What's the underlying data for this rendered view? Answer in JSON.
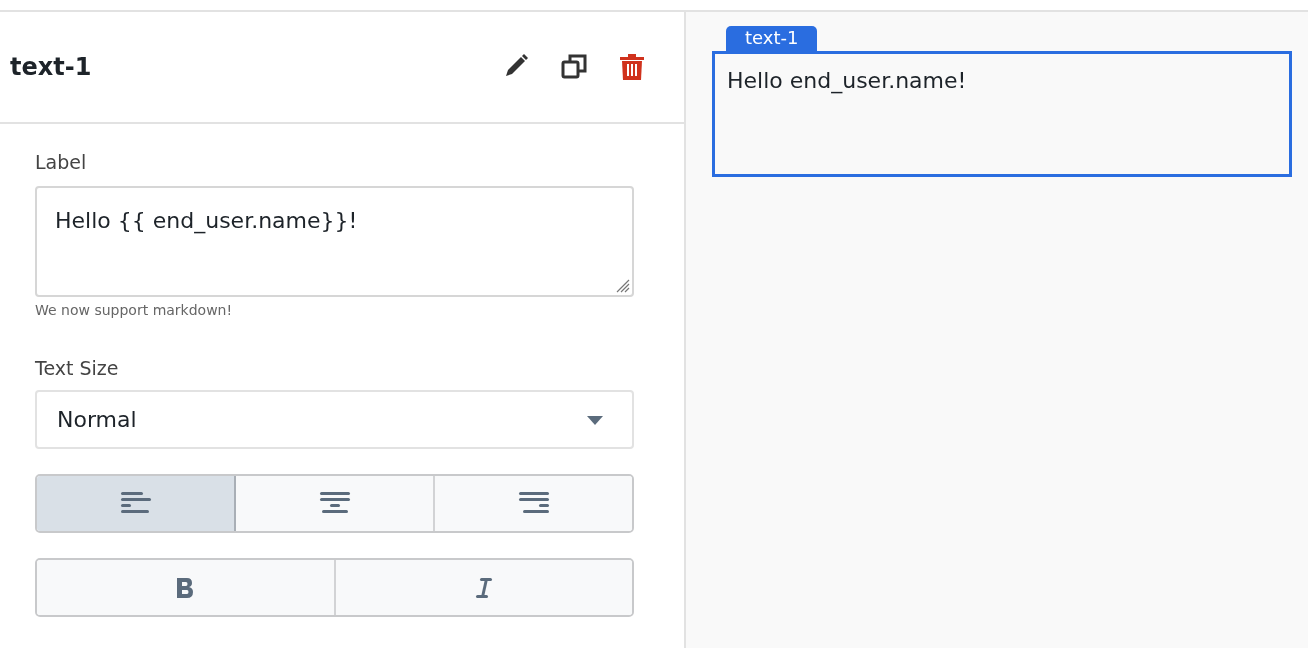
{
  "inspector": {
    "title": "text-1",
    "actions": [
      {
        "kind": "edit"
      },
      {
        "kind": "duplicate"
      },
      {
        "kind": "delete"
      }
    ],
    "label": {
      "caption": "Label",
      "value": "Hello {{ end_user.name}}!",
      "hint": "We now support markdown!"
    },
    "text_size": {
      "caption": "Text Size",
      "value": "Normal"
    },
    "alignment": [
      {
        "kind": "left",
        "selected": true
      },
      {
        "kind": "center",
        "selected": false
      },
      {
        "kind": "right",
        "selected": false
      }
    ],
    "styles": [
      {
        "kind": "bold",
        "selected": false
      },
      {
        "kind": "italic",
        "selected": false
      }
    ]
  },
  "canvas": {
    "element": {
      "tag": "text-1",
      "text": "Hello end_user.name!",
      "selected": true
    }
  }
}
